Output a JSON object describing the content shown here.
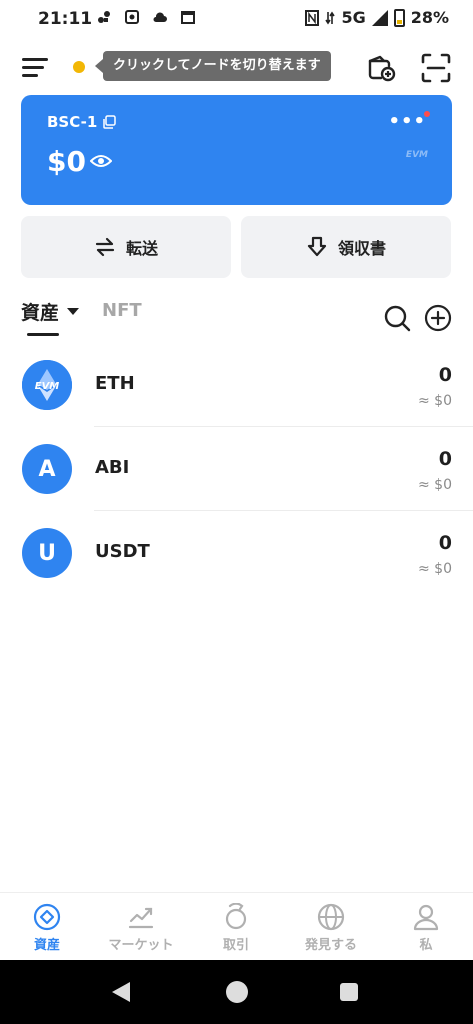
{
  "status_bar": {
    "time": "21:11",
    "network": "5G",
    "battery": "28%",
    "icons": [
      "notification-icon",
      "settings-icon",
      "cloud-icon",
      "calendar-icon",
      "nfc-icon",
      "data-icon",
      "signal-icon",
      "battery-icon"
    ]
  },
  "header": {
    "node_dot_color": "#f2b705",
    "node_tooltip": "クリックしてノードを切り替えます",
    "icons": [
      "menu-icon",
      "wallet-add-icon",
      "scan-icon"
    ]
  },
  "card": {
    "network": "BSC-1",
    "balance": "$0",
    "more": "•••",
    "watermark": "EVM",
    "color": "#2f84f0"
  },
  "actions": {
    "transfer_label": "転送",
    "receive_label": "領収書"
  },
  "tabs": {
    "assets_label": "資産",
    "nft_label": "NFT"
  },
  "tokens": [
    {
      "symbol": "ETH",
      "amount": "0",
      "value": "≈ $0",
      "avatar": "EVM"
    },
    {
      "symbol": "ABI",
      "amount": "0",
      "value": "≈ $0",
      "avatar": "A"
    },
    {
      "symbol": "USDT",
      "amount": "0",
      "value": "≈ $0",
      "avatar": "U"
    }
  ],
  "bottom_nav": [
    {
      "label": "資産",
      "icon": "assets-icon",
      "active": true
    },
    {
      "label": "マーケット",
      "icon": "market-icon",
      "active": false
    },
    {
      "label": "取引",
      "icon": "trade-icon",
      "active": false
    },
    {
      "label": "発見する",
      "icon": "discover-icon",
      "active": false
    },
    {
      "label": "私",
      "icon": "profile-icon",
      "active": false
    }
  ],
  "accent_color": "#2f84f0"
}
